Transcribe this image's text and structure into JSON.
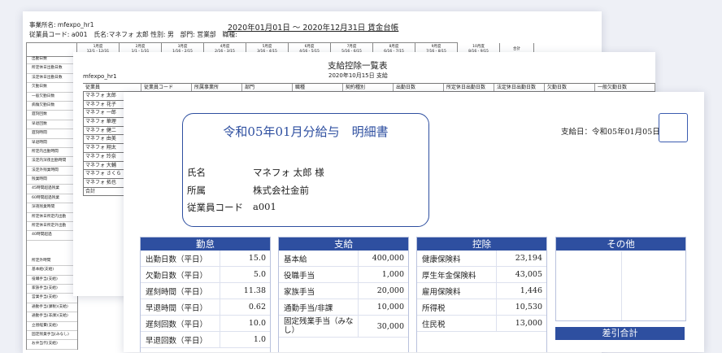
{
  "ledger": {
    "office": "事業所名: mfexpo_hr1",
    "employee_line": "従業員コード: a001　氏名:マネフォ 太郎 性別: 男　部門: 営業部　職種:",
    "title": "2020年01月01日 ～ 2020年12月31日 賃金台帳",
    "periods": [
      {
        "name": "1月度",
        "range": "12/1 - 12/31"
      },
      {
        "name": "2月度",
        "range": "1/1 - 1/31"
      },
      {
        "name": "3月度",
        "range": "1/16 - 2/15"
      },
      {
        "name": "4月度",
        "range": "2/16 - 3/15"
      },
      {
        "name": "5月度",
        "range": "3/16 - 4/15"
      },
      {
        "name": "6月度",
        "range": "4/16 - 5/15"
      },
      {
        "name": "7月度",
        "range": "5/16 - 6/15"
      },
      {
        "name": "8月度",
        "range": "6/16 - 7/15"
      },
      {
        "name": "9月度",
        "range": "7/16 - 8/15"
      },
      {
        "name": "10月度",
        "range": "8/16 - 9/15"
      }
    ],
    "total_label": "合計",
    "rows_top": [
      "出勤日数",
      "所定休日出勤日数",
      "法定休日出勤日数",
      "欠勤日数",
      "一般欠勤日数",
      "病傷欠勤日数",
      "遅刻回数",
      "早退回数",
      "遅刻時間",
      "早退時間",
      "所定内出勤時間",
      "法定内深夜出勤時間",
      "法定外残業時間",
      "残業時間",
      "45時間超過残業",
      "60時間超過残業",
      "深夜残業時間",
      "所定休日所定内出勤",
      "所定休日所定外出勤",
      "40時間超過"
    ],
    "rows_bottom": [
      "所定外時間",
      "基本給(支給)",
      "役職手当(支給)",
      "家族手当(支給)",
      "営業手当(支給)",
      "通勤手当(課税)(支給)",
      "通勤手当(非課)(支給)",
      "立替経費(支給)",
      "固定残業手当(みなし)",
      "お弁当代(支給)"
    ]
  },
  "deduction": {
    "company": "mfexpo_hr1",
    "title": "支給控除一覧表",
    "date": "2020年10月15日 支給",
    "columns": [
      "従業員",
      "従業員コード",
      "所属事業所",
      "部門",
      "職種",
      "契約種別",
      "出勤日数",
      "所定休日出勤日数",
      "法定休日出勤日数",
      "欠勤日数",
      "一般欠勤日数"
    ],
    "names": [
      "マネフォ 太郎",
      "マネフォ 花子",
      "マネフォ 一郎",
      "マネフォ 華理",
      "マネフォ 健二",
      "マネフォ 由美",
      "マネフォ 翔太",
      "マネフォ 玲奈",
      "マネフォ 大輔",
      "マネフォ さくら",
      "マネフォ 拓也",
      "合計"
    ]
  },
  "slip": {
    "title": "令和05年01月分給与　明細書",
    "name_label": "氏名",
    "name_value": "マネフォ 太郎 様",
    "dept_label": "所属",
    "dept_value": "株式会社金前",
    "code_label": "従業員コード",
    "code_value": "a001",
    "pay_date": "支給日：令和05年01月05日",
    "attendance": {
      "header": "勤怠",
      "rows": [
        {
          "label": "出勤日数（平日）",
          "value": "15.0"
        },
        {
          "label": "欠勤日数（平日）",
          "value": "5.0"
        },
        {
          "label": "遅刻時間（平日）",
          "value": "11.38"
        },
        {
          "label": "早退時間（平日）",
          "value": "0.62"
        },
        {
          "label": "遅刻回数（平日）",
          "value": "10.0"
        },
        {
          "label": "早退回数（平日）",
          "value": "1.0"
        }
      ]
    },
    "payments": {
      "header": "支給",
      "rows": [
        {
          "label": "基本給",
          "value": "400,000"
        },
        {
          "label": "役職手当",
          "value": "1,000"
        },
        {
          "label": "家族手当",
          "value": "20,000"
        },
        {
          "label": "通勤手当/非課",
          "value": "10,000"
        },
        {
          "label": "固定残業手当（みなし）",
          "value": "30,000"
        }
      ]
    },
    "deductions": {
      "header": "控除",
      "rows": [
        {
          "label": "健康保険料",
          "value": "23,194"
        },
        {
          "label": "厚生年金保険料",
          "value": "43,005"
        },
        {
          "label": "雇用保険料",
          "value": "1,446"
        },
        {
          "label": "所得税",
          "value": "10,530"
        },
        {
          "label": "住民税",
          "value": "13,000"
        }
      ]
    },
    "other_header": "その他",
    "net_header": "差引合計"
  },
  "colors": {
    "accent": "#2e4fa0",
    "background": "#eef0f6"
  }
}
